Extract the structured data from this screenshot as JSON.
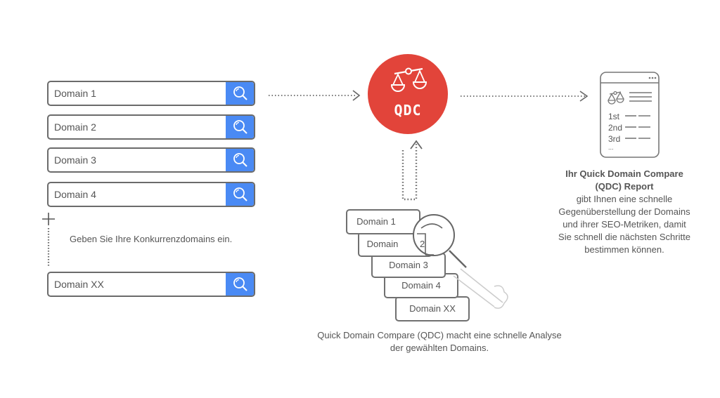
{
  "inputs": {
    "fields": [
      {
        "value": "Domain 1"
      },
      {
        "value": "Domain 2"
      },
      {
        "value": "Domain 3"
      },
      {
        "value": "Domain 4"
      },
      {
        "value": "Domain XX"
      }
    ],
    "search_icon": "search-icon",
    "add_icon": "plus-icon",
    "hint": "Geben Sie Ihre Konkurrenzdomains ein."
  },
  "qdc": {
    "label": "QDC",
    "icon": "scales-icon",
    "color": "#e2443a"
  },
  "stack": {
    "cards": [
      "Domain 1",
      "Domain",
      "Domain 3",
      "Domain 4",
      "Domain XX"
    ],
    "magnified_label": "2",
    "caption_line1": "Quick Domain Compare (QDC) macht eine schnelle Analyse",
    "caption_line2": "der gewählten Domains."
  },
  "report": {
    "icon": "report-document-icon",
    "ranks": [
      "1st",
      "2nd",
      "3rd",
      "..."
    ],
    "title_line1": "Ihr Quick Domain Compare",
    "title_line2": "(QDC) Report",
    "body": [
      "gibt Ihnen eine schnelle",
      "Gegenüberstellung der Domains",
      "und ihrer SEO-Metriken, damit",
      "Sie schnell die nächsten Schritte",
      "bestimmen können."
    ]
  },
  "colors": {
    "accent_blue": "#4a8af4",
    "accent_red": "#e2443a",
    "stroke_gray": "#6b6b6b"
  }
}
